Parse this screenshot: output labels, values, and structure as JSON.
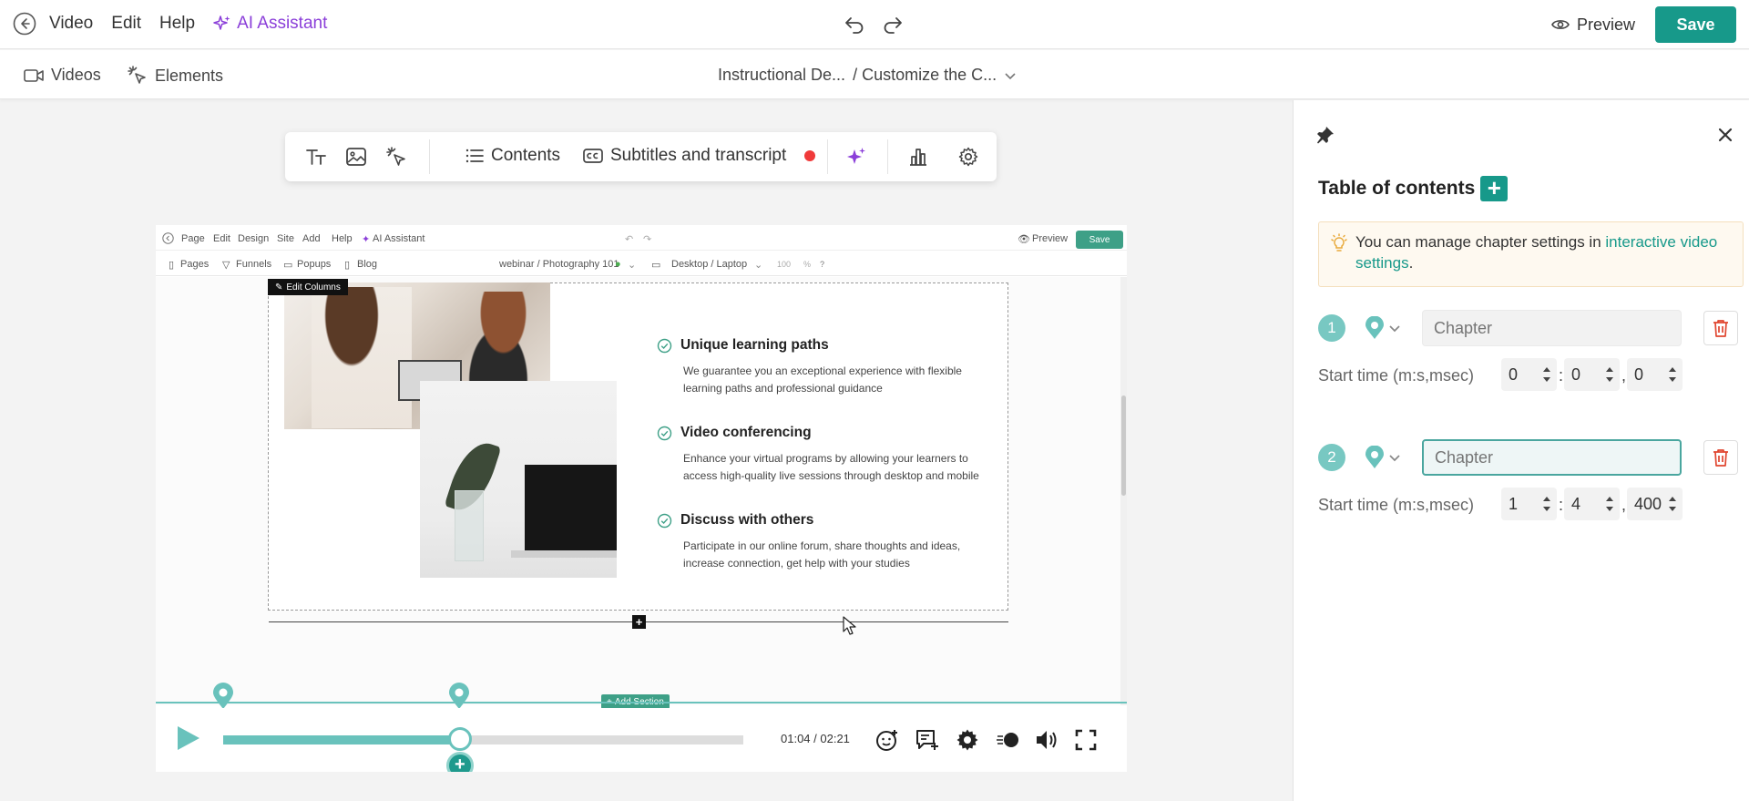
{
  "topbar": {
    "menu": [
      "Video",
      "Edit",
      "Help"
    ],
    "ai_label": "AI Assistant",
    "preview_label": "Preview",
    "save_label": "Save"
  },
  "subbar": {
    "videos_label": "Videos",
    "elements_label": "Elements",
    "breadcrumb_project": "Instructional De...",
    "breadcrumb_video": "/ Customize the C..."
  },
  "toolbar": {
    "contents_label": "Contents",
    "subtitles_label": "Subtitles and transcript"
  },
  "inner_page": {
    "menu": [
      "Page",
      "Edit",
      "Design",
      "Site",
      "Add",
      "Help"
    ],
    "ai_label": "AI Assistant",
    "preview_label": "Preview",
    "save_label": "Save",
    "nav": [
      "Pages",
      "Funnels",
      "Popups",
      "Blog"
    ],
    "site_path": "webinar / Photography 101",
    "device": "Desktop / Laptop",
    "zoom": "100",
    "zoom_unit": "%",
    "help": "?",
    "edit_columns": "Edit Columns",
    "features": [
      {
        "title": "Unique learning paths",
        "desc": "We guarantee you an exceptional experience with flexible learning paths and professional guidance"
      },
      {
        "title": "Video conferencing",
        "desc": "Enhance your virtual programs by allowing your learners to access high-quality live sessions through desktop and mobile"
      },
      {
        "title": "Discuss with others",
        "desc": "Participate in our online forum, share thoughts and ideas, increase connection, get help with your studies"
      }
    ],
    "add_section": "Add Section"
  },
  "player": {
    "time": "01:04 / 02:21",
    "progress": 0.455
  },
  "panel": {
    "title": "Table of contents",
    "tip_text": "You can manage chapter settings in ",
    "tip_link": "interactive video settings",
    "tip_end": ".",
    "start_time_label": "Start time (m:s,msec)",
    "chapters": [
      {
        "num": "1",
        "placeholder": "Chapter",
        "min": "0",
        "sec": "0",
        "msec": "0"
      },
      {
        "num": "2",
        "placeholder": "Chapter",
        "min": "1",
        "sec": "4",
        "msec": "400"
      }
    ]
  },
  "colors": {
    "accent": "#17998a",
    "teal_light": "#69c2bc",
    "ai_purple": "#8b3fd9",
    "record_red": "#f03a3a",
    "delete_red": "#e0452f"
  }
}
